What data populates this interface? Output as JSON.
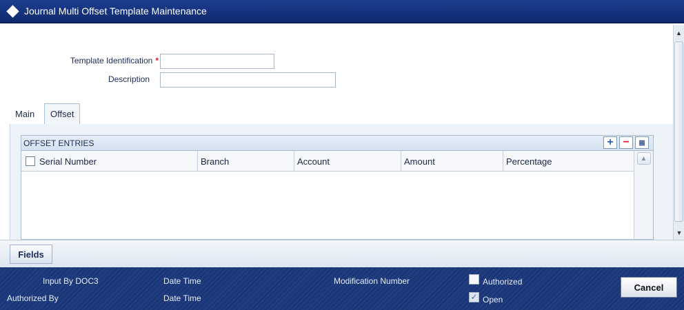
{
  "window": {
    "title": "Journal Multi Offset Template Maintenance"
  },
  "form": {
    "template_id_label": "Template Identification",
    "required_marker": "*",
    "template_id_value": "",
    "description_label": "Description",
    "description_value": ""
  },
  "tabs": [
    {
      "label": "Main",
      "active": false
    },
    {
      "label": "Offset",
      "active": true
    }
  ],
  "offset_grid": {
    "title": "OFFSET ENTRIES",
    "add_icon": "+",
    "delete_icon": "−",
    "list_icon": "≣",
    "columns": [
      "Serial Number",
      "Branch",
      "Account",
      "Amount",
      "Percentage"
    ],
    "rows": []
  },
  "fields_button": "Fields",
  "footer": {
    "input_by_label": "Input By",
    "input_by_value": "DOC3",
    "authorized_by_label": "Authorized By",
    "date_time_label": "Date Time",
    "modification_number_label": "Modification Number",
    "authorized_label": "Authorized",
    "authorized_checked": false,
    "open_label": "Open",
    "open_checked": true,
    "cancel_label": "Cancel"
  },
  "icons": {
    "title_icon": "diamond-icon",
    "scroll_up": "chevron-up-icon",
    "scroll_down": "chevron-down-icon"
  }
}
